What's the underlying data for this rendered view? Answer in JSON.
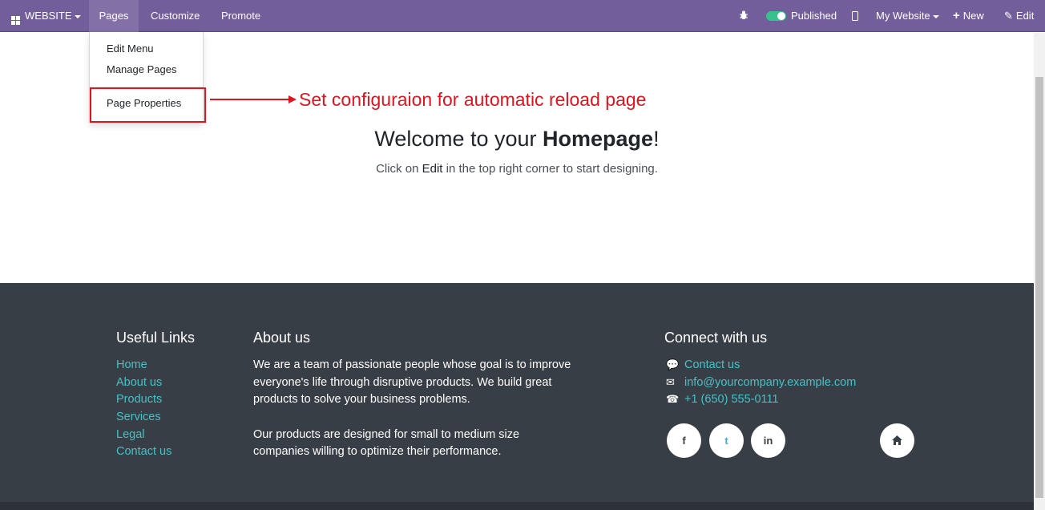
{
  "topbar": {
    "apps_label": "WEBSITE",
    "nav": [
      "Pages",
      "Customize",
      "Promote"
    ],
    "published_label": "Published",
    "website_label": "My Website",
    "new_label": "New",
    "edit_label": "Edit",
    "bug_icon": "bug-icon",
    "bg_color": "#715e9a"
  },
  "pages_menu": {
    "items": [
      "Edit Menu",
      "Manage Pages",
      "Page Properties"
    ]
  },
  "annotation": {
    "text": "Set configuraion for automatic reload page",
    "color": "#e0141e"
  },
  "main": {
    "welcome_prefix": "Welcome to your ",
    "welcome_bold": "Homepage",
    "welcome_suffix": "!",
    "sub_prefix": "Click on ",
    "sub_bold": "Edit",
    "sub_suffix": " in the top right corner to start designing."
  },
  "footer": {
    "useful_links_title": "Useful Links",
    "links": [
      "Home",
      "About us",
      "Products",
      "Services",
      "Legal",
      "Contact us"
    ],
    "about_title": "About us",
    "about_lines": [
      "We are a team of passionate people whose goal is to improve",
      "everyone's life through disruptive products. We build great",
      "products to solve your business problems.",
      "Our products are designed for small to medium size",
      "companies willing to optimize their performance."
    ],
    "connect_title": "Connect with us",
    "contact_us": "Contact us",
    "email": "info@yourcompany.example.com",
    "phone": "+1 (650) 555-0111",
    "social": [
      "f",
      "t",
      "in"
    ],
    "link_color": "#47c1c8",
    "bg_color": "#383e45"
  }
}
